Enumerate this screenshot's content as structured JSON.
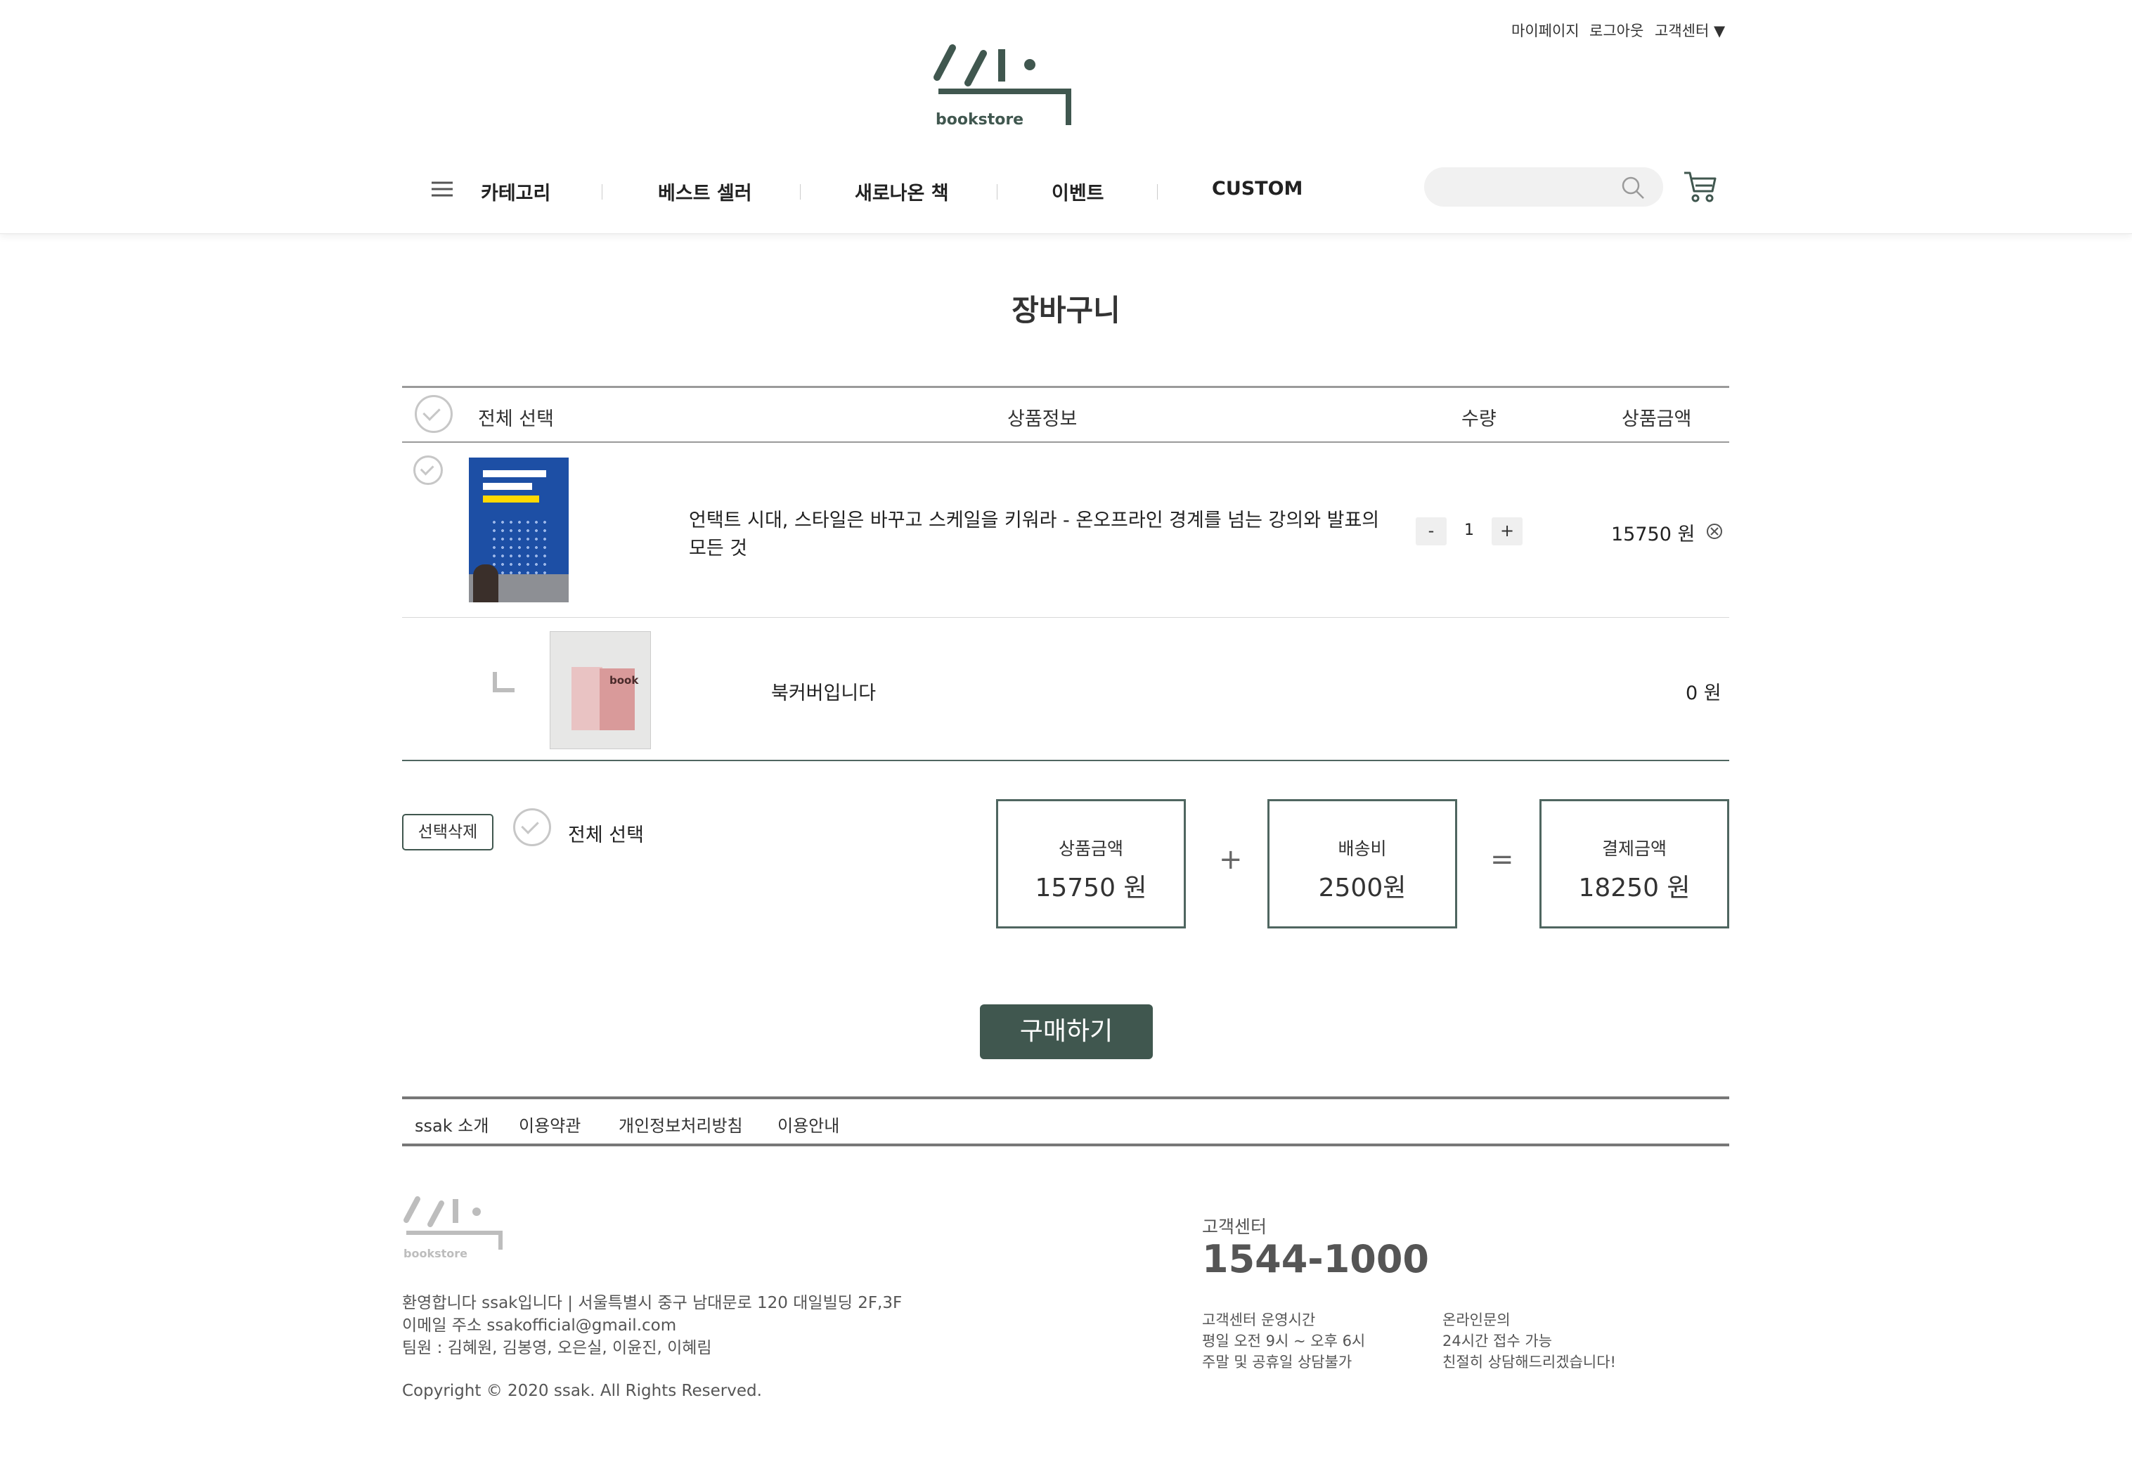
{
  "header": {
    "toplinks": [
      "마이페이지",
      "로그아웃",
      "고객센터 ▼"
    ],
    "logo_text": "bookstore",
    "nav": [
      "카테고리",
      "베스트 셀러",
      "새로나온 책",
      "이벤트",
      "CUSTOM"
    ],
    "search_placeholder": ""
  },
  "page": {
    "title": "장바구니"
  },
  "table": {
    "headers": [
      "전체 선택",
      "상품정보",
      "수량",
      "상품금액"
    ],
    "items": [
      {
        "title_line1": "언택트 시대, 스타일은 바꾸고 스케일을 키워라 - 온오프라인 경계를 넘는 강의와 발표의",
        "title_line2": "모든 것",
        "quantity": "1",
        "price": "15750 원",
        "minus": "-",
        "plus": "+"
      },
      {
        "title": "북커버입니다",
        "price": "0 원",
        "cover_text": "book"
      }
    ]
  },
  "summary": {
    "delete_label": "선택삭제",
    "select_all": "전체 선택",
    "boxes": [
      {
        "label": "상품금액",
        "value": "15750 원"
      },
      {
        "label": "배송비",
        "value": "2500원"
      },
      {
        "label": "결제금액",
        "value": "18250 원"
      }
    ],
    "plus": "+",
    "equals": "=",
    "buy_label": "구매하기"
  },
  "footer": {
    "links": [
      "ssak 소개",
      "이용약관",
      "개인정보처리방침",
      "이용안내"
    ],
    "logo_text": "bookstore",
    "info_line1": "환영합니다 ssak입니다   |   서울특별시 중구 남대문로 120 대일빌딩 2F,3F",
    "info_line2": "이메일 주소 ssakofficial@gmail.com",
    "info_line3": "팀원 : 김혜원, 김봉영, 오은실, 이윤진, 이혜림",
    "copyright": "Copyright © 2020 ssak. All Rights Reserved.",
    "cs_label": "고객센터",
    "cs_phone": "1544-1000",
    "hours_title": "고객센터 운영시간",
    "hours_line1": "평일 오전 9시 ~ 오후 6시",
    "hours_line2": "주말 및 공휴일 상담불가",
    "online_title": "온라인문의",
    "online_line1": "24시간 접수 가능",
    "online_line2": "친절히 상담해드리겠습니다!"
  },
  "colors": {
    "brand": "#40574f",
    "border": "#9a9a9a"
  }
}
